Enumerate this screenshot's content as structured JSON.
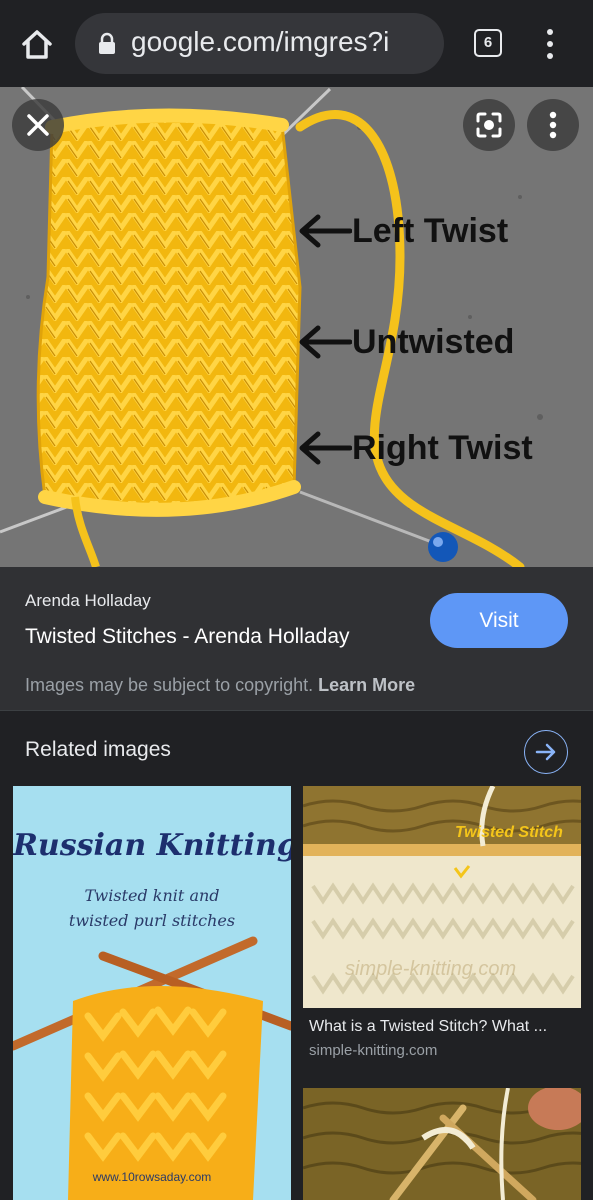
{
  "toolbar": {
    "url": "google.com/imgres?i",
    "tab_count": "6",
    "icons": {
      "home": "home-icon",
      "lock": "lock-icon",
      "tabs": "tab-switcher-icon",
      "menu": "more-vert-icon"
    }
  },
  "preview": {
    "annotations": [
      "Left Twist",
      "Untwisted",
      "Right Twist"
    ],
    "overlay_icons": [
      "close-icon",
      "lens-icon",
      "more-vert-icon"
    ],
    "colors": {
      "yarn": "#f5c21b",
      "background": "#747474"
    }
  },
  "result": {
    "source": "Arenda Holladay",
    "title": "Twisted Stitches - Arenda Holladay",
    "visit_label": "Visit",
    "copyright_text": "Images may be subject to copyright.",
    "learn_more": "Learn More"
  },
  "related": {
    "heading": "Related images",
    "cards": [
      {
        "title_line": "Russian Knitting",
        "subtitle_1": "Twisted knit and",
        "subtitle_2": "twisted purl stitches",
        "url": "www.10rowsaday.com"
      },
      {
        "overlay_label": "Twisted Stitch",
        "watermark": "simple-knitting.com",
        "title": "What is a Twisted Stitch? What ...",
        "site": "simple-knitting.com"
      }
    ]
  },
  "colors": {
    "accent": "#5e97f6",
    "link": "#8ab4f8",
    "surface": "#303134",
    "page": "#202124"
  }
}
